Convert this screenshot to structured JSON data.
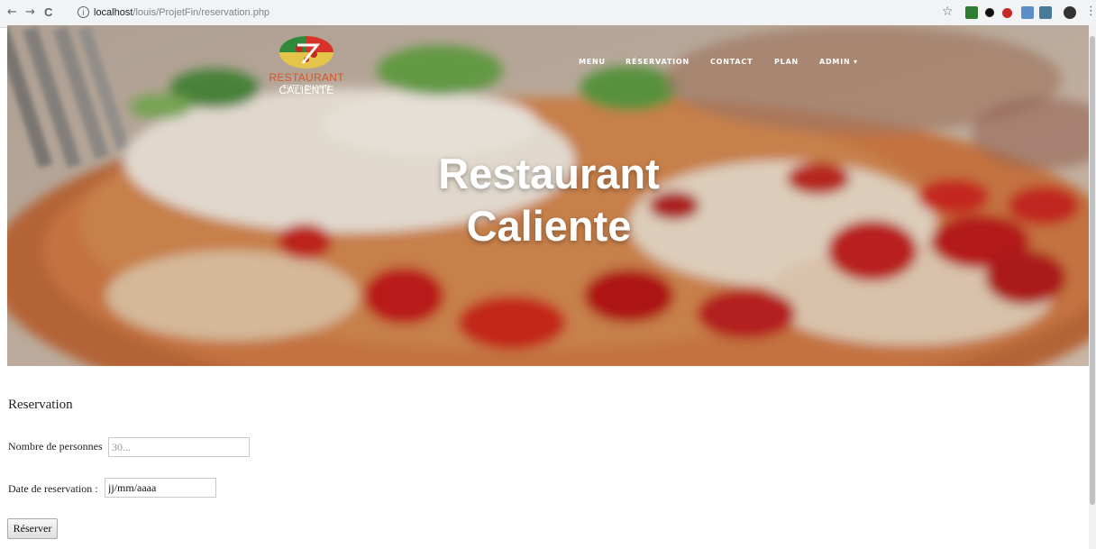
{
  "browser": {
    "back": "←",
    "forward": "→",
    "reload": "C",
    "info": "i",
    "url_host": "localhost",
    "url_path": "/louis/ProjetFin/reservation.php",
    "star": "☆"
  },
  "header": {
    "logo_main_a": "RESTAURANT",
    "logo_main_b": " CALIENTE",
    "logo_sub": "TUTTI QUANTI",
    "menu": [
      {
        "label": "MENU"
      },
      {
        "label": "RÉSERVATION"
      },
      {
        "label": "CONTACT"
      },
      {
        "label": "PLAN"
      },
      {
        "label": "ADMIN ▾"
      }
    ]
  },
  "hero": {
    "title_line1": "Restaurant",
    "title_line2": "Caliente"
  },
  "form": {
    "heading": "Reservation",
    "persons_label": "Nombre de personnes",
    "persons_placeholder": "30...",
    "date_label": "Date de reservation :",
    "date_value": "jj/mm/aaaa",
    "submit_label": "Réserver"
  },
  "colors": {
    "accent_orange": "#d8552a",
    "hero_text": "#ffffff"
  }
}
